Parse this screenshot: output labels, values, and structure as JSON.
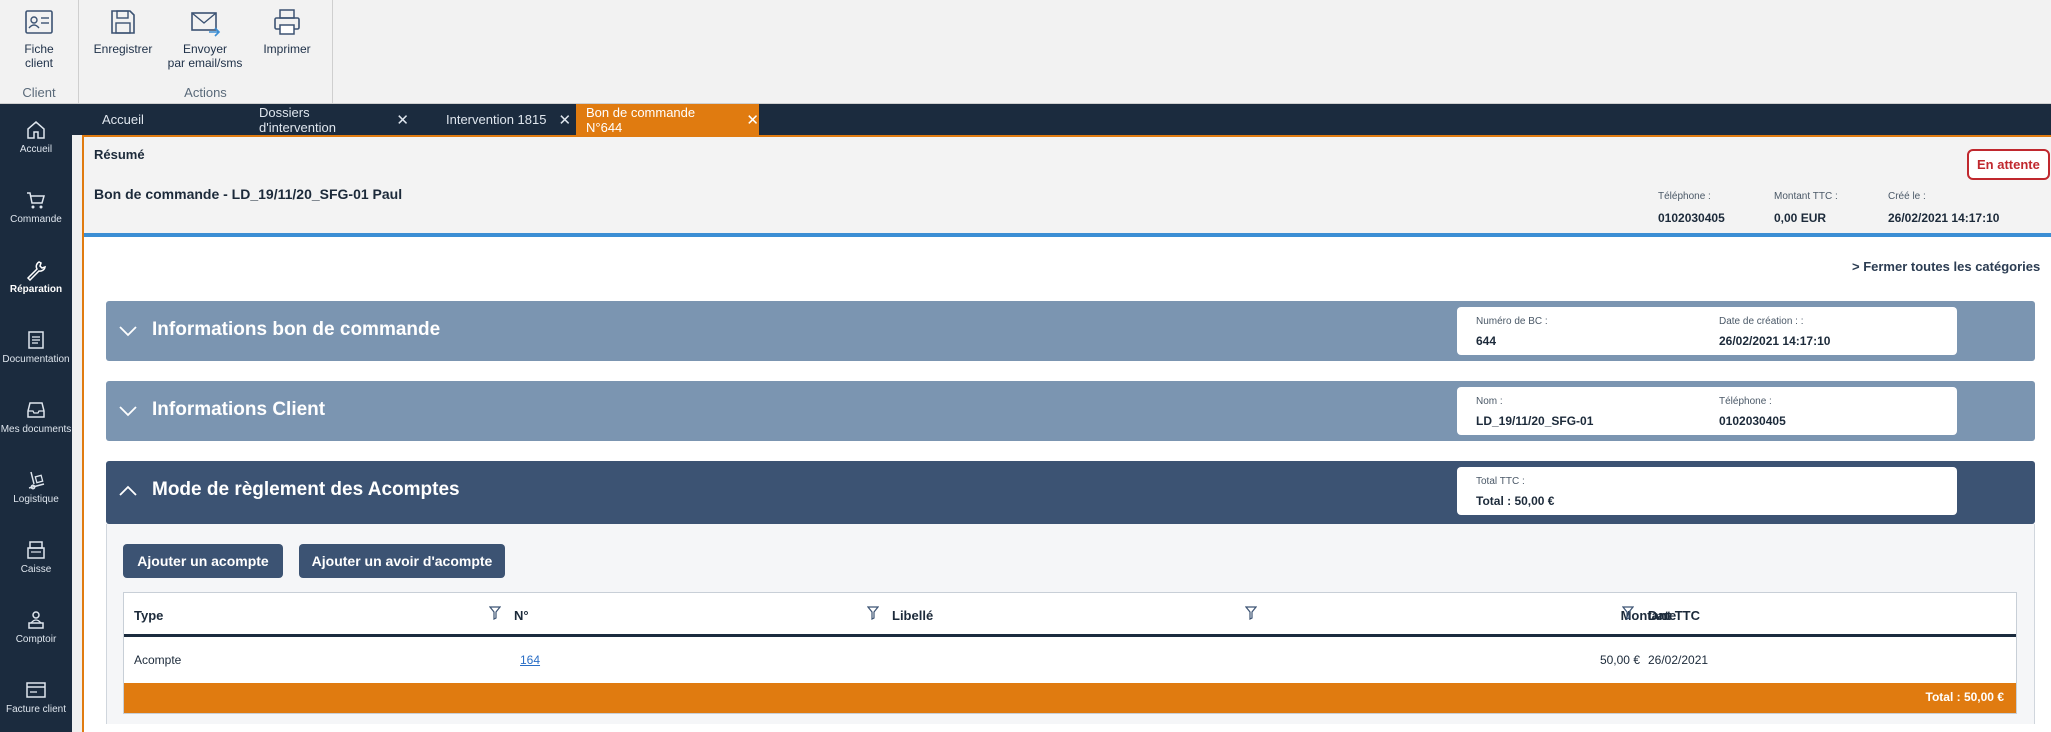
{
  "ribbon": {
    "groups": [
      {
        "label": "Client",
        "buttons": [
          {
            "label_line1": "Fiche",
            "label_line2": "client",
            "icon": "client-card-icon"
          }
        ]
      },
      {
        "label": "Actions",
        "buttons": [
          {
            "label_line1": "Enregistrer",
            "label_line2": "",
            "icon": "save-icon"
          },
          {
            "label_line1": "Envoyer",
            "label_line2": "par email/sms",
            "icon": "send-email-icon"
          },
          {
            "label_line1": "Imprimer",
            "label_line2": "",
            "icon": "print-icon"
          }
        ]
      }
    ]
  },
  "nav": {
    "items": [
      {
        "label": "Accueil",
        "icon": "home-icon"
      },
      {
        "label": "Commande",
        "icon": "cart-icon"
      },
      {
        "label": "Réparation",
        "icon": "wrench-icon"
      },
      {
        "label": "Documentation",
        "icon": "document-icon"
      },
      {
        "label": "Mes documents",
        "icon": "inbox-icon"
      },
      {
        "label": "Logistique",
        "icon": "logistics-icon"
      },
      {
        "label": "Caisse",
        "icon": "cash-register-icon"
      },
      {
        "label": "Comptoir",
        "icon": "counter-icon"
      },
      {
        "label": "Facture client",
        "icon": "invoice-icon"
      }
    ],
    "active": "Réparation"
  },
  "tabs": [
    {
      "label": "Accueil",
      "closable": false
    },
    {
      "label": "Dossiers d'intervention",
      "closable": true
    },
    {
      "label": "Intervention 1815",
      "closable": true
    },
    {
      "label": "Bon de commande N°644",
      "closable": true,
      "active": true
    }
  ],
  "summary": {
    "label": "Résumé",
    "title": "Bon de commande - LD_19/11/20_SFG-01 Paul",
    "status": "En attente",
    "meta": [
      {
        "key": "Téléphone :",
        "value": "0102030405"
      },
      {
        "key": "Montant TTC :",
        "value": "0,00 EUR"
      },
      {
        "key": "Créé le :",
        "value": "26/02/2021 14:17:10"
      }
    ]
  },
  "close_all": "> Fermer toutes les catégories",
  "panels": [
    {
      "title": "Informations bon de commande",
      "expanded": false,
      "fields": [
        {
          "key": "Numéro de BC :",
          "value": "644"
        },
        {
          "key": "Date de création : :",
          "value": "26/02/2021 14:17:10"
        }
      ]
    },
    {
      "title": "Informations Client",
      "expanded": false,
      "fields": [
        {
          "key": "Nom :",
          "value": "LD_19/11/20_SFG-01"
        },
        {
          "key": "Téléphone :",
          "value": "0102030405"
        }
      ]
    },
    {
      "title": "Mode de règlement des Acomptes",
      "expanded": true,
      "fields": [
        {
          "key": "Total TTC :",
          "value": "Total : 50,00 €"
        }
      ]
    }
  ],
  "acomptes": {
    "buttons": [
      "Ajouter un acompte",
      "Ajouter un avoir d'acompte"
    ],
    "columns": [
      "Type",
      "N°",
      "Libellé",
      "Montant TTC",
      "Date"
    ],
    "rows": [
      {
        "type": "Acompte",
        "numero": "164",
        "libelle": "",
        "montant": "50,00 €",
        "date": "26/02/2021"
      }
    ],
    "footer_total": "Total : 50,00 €"
  },
  "colors": {
    "navy": "#1b2b3e",
    "accent_orange": "#e07b10",
    "panel_light": "#7b95b1",
    "panel_dark": "#3c5373",
    "status_red": "#c0282e",
    "link_blue": "#2a6ec6"
  }
}
